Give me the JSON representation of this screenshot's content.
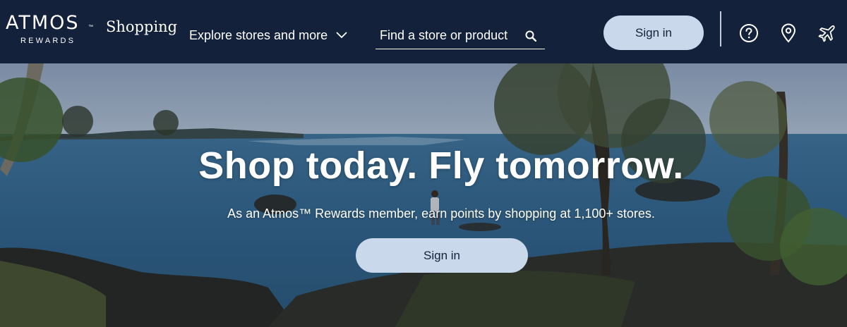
{
  "header": {
    "logo_text": "ATMOS",
    "logo_tm": "™",
    "logo_sub": "REWARDS",
    "shopping_label": "Shopping",
    "explore_label": "Explore stores and more",
    "search_placeholder": "Find a store or product",
    "sign_in_label": "Sign in",
    "icons": [
      "help-icon",
      "location-pin-icon",
      "airplane-icon"
    ]
  },
  "hero": {
    "title": "Shop today. Fly tomorrow.",
    "subtitle": "As an Atmos™ Rewards member, earn points by shopping at 1,100+ stores.",
    "sign_in_label": "Sign in"
  },
  "colors": {
    "nav_background": "#13213a",
    "button_background": "#c9d8ea",
    "button_text": "#13213a"
  }
}
